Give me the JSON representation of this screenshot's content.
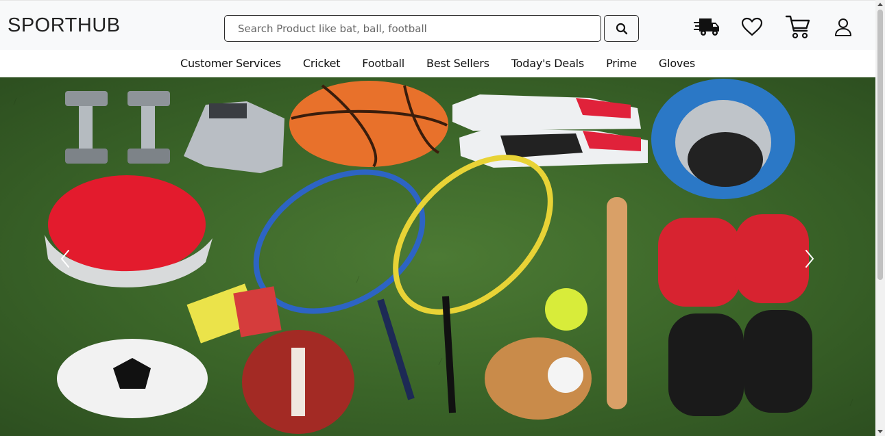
{
  "brand": {
    "name": "SPORTHUB"
  },
  "search": {
    "placeholder": "Search Product like bat, ball, football",
    "value": ""
  },
  "header_icons": [
    "delivery-truck-icon",
    "heart-icon",
    "cart-icon",
    "user-icon"
  ],
  "nav": {
    "items": [
      {
        "label": "Customer Services"
      },
      {
        "label": "Cricket"
      },
      {
        "label": "Football"
      },
      {
        "label": "Best Sellers"
      },
      {
        "label": "Today's Deals"
      },
      {
        "label": "Prime"
      },
      {
        "label": "Gloves"
      }
    ]
  },
  "carousel": {
    "prev_icon": "chevron-left-icon",
    "next_icon": "chevron-right-icon"
  },
  "colors": {
    "header_bg": "#f8f9fa",
    "grass": "#3a6428"
  }
}
